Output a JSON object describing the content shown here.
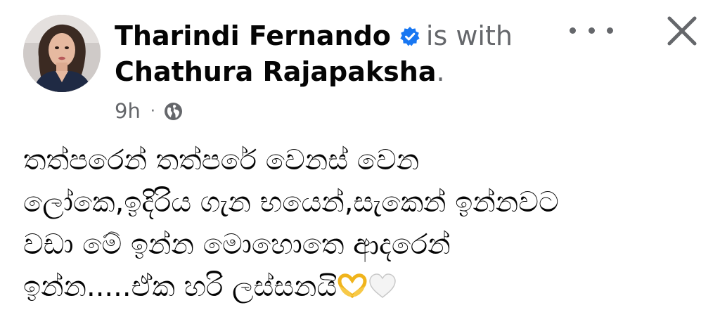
{
  "post": {
    "author": "Tharindi Fernando",
    "author_verified": true,
    "is_with_label": "is with",
    "tagged_person": "Chathura Rajapaksha",
    "period": ".",
    "timestamp": "9h",
    "separator": "·",
    "audience_icon": "globe-icon",
    "body_lines": [
      "තත්පරෙන් තත්පරේ වෙනස් වෙන",
      "ලෝකෙ,ඉදිරිය ගැන භයෙන්,සැකෙන් ඉන්නවට",
      "වඩා මේ ඉන්න මොහොතෙ ආදරෙන්",
      "ඉන්න.....ඒක හරි ලස්සනයි"
    ],
    "body_emojis": [
      "heart-hands-emoji",
      "white-heart-emoji"
    ]
  },
  "controls": {
    "more_icon": "more-horizontal-icon",
    "close_icon": "close-icon"
  },
  "colors": {
    "text_primary": "#050505",
    "text_secondary": "#65676b",
    "verified_blue": "#1877f2",
    "background": "#ffffff"
  }
}
